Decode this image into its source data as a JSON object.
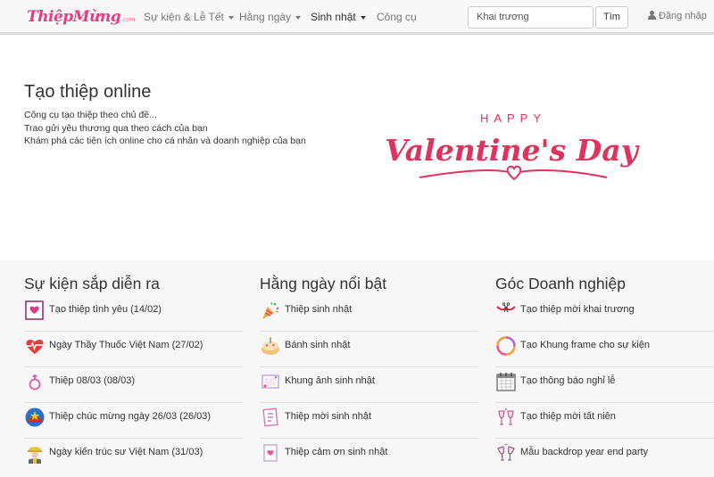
{
  "navbar": {
    "logo_main": "ThiệpMừng",
    "logo_suffix": ".com",
    "menu": [
      {
        "label": "Sự kiện & Lễ Tết",
        "has_caret": true
      },
      {
        "label": "Hằng ngày",
        "has_caret": true
      },
      {
        "label": "Sinh nhật",
        "has_caret": true
      },
      {
        "label": "Công cụ",
        "has_caret": false
      }
    ],
    "search": {
      "value": "Khai trương",
      "button_label": "Tìm"
    },
    "login_label": "Đăng nhập"
  },
  "hero": {
    "title": "Tạo thiệp online",
    "lines": [
      "Công cụ tạo thiệp theo chủ đề...",
      "Trao gửi yêu thương qua theo cách của bạn",
      "Khám phá các tiện ích online cho cá nhân và doanh nghiệp của bạn"
    ],
    "banner": {
      "happy": "HAPPY",
      "main": "Valentine's Day"
    }
  },
  "columns": [
    {
      "title": "Sự kiện sắp diễn ra",
      "items": [
        {
          "label": "Tạo thiệp tình yêu (14/02)",
          "icon": "love-card-icon"
        },
        {
          "label": "Ngày Thầy Thuốc Việt Nam (27/02)",
          "icon": "heart-pulse-icon"
        },
        {
          "label": "Thiệp 08/03 (08/03)",
          "icon": "women-symbol-icon"
        },
        {
          "label": "Thiệp chúc mừng ngày 26/03 (26/03)",
          "icon": "youth-union-icon"
        },
        {
          "label": "Ngày kiến trúc sư Việt Nam (31/03)",
          "icon": "architect-icon"
        }
      ]
    },
    {
      "title": "Hằng ngày nổi bật",
      "items": [
        {
          "label": "Thiệp sinh nhật",
          "icon": "party-popper-icon"
        },
        {
          "label": "Bánh sinh nhật",
          "icon": "birthday-cake-icon"
        },
        {
          "label": "Khung ảnh sinh nhật",
          "icon": "photo-frame-icon"
        },
        {
          "label": "Thiệp mời sinh nhật",
          "icon": "invitation-card-icon"
        },
        {
          "label": "Thiệp cảm ơn sinh nhật",
          "icon": "thank-you-card-icon"
        }
      ]
    },
    {
      "title": "Góc Doanh nghiệp",
      "items": [
        {
          "label": "Tạo thiệp mời khai trương",
          "icon": "ribbon-cutting-icon"
        },
        {
          "label": "Tạo Khung frame cho sự kiện",
          "icon": "circle-frame-icon"
        },
        {
          "label": "Tạo thông báo nghỉ lễ",
          "icon": "calendar-icon"
        },
        {
          "label": "Tạo thiệp mời tất niên",
          "icon": "champagne-glasses-icon"
        },
        {
          "label": "Mẫu backdrop year end party",
          "icon": "champagne-toast-icon"
        }
      ]
    }
  ]
}
